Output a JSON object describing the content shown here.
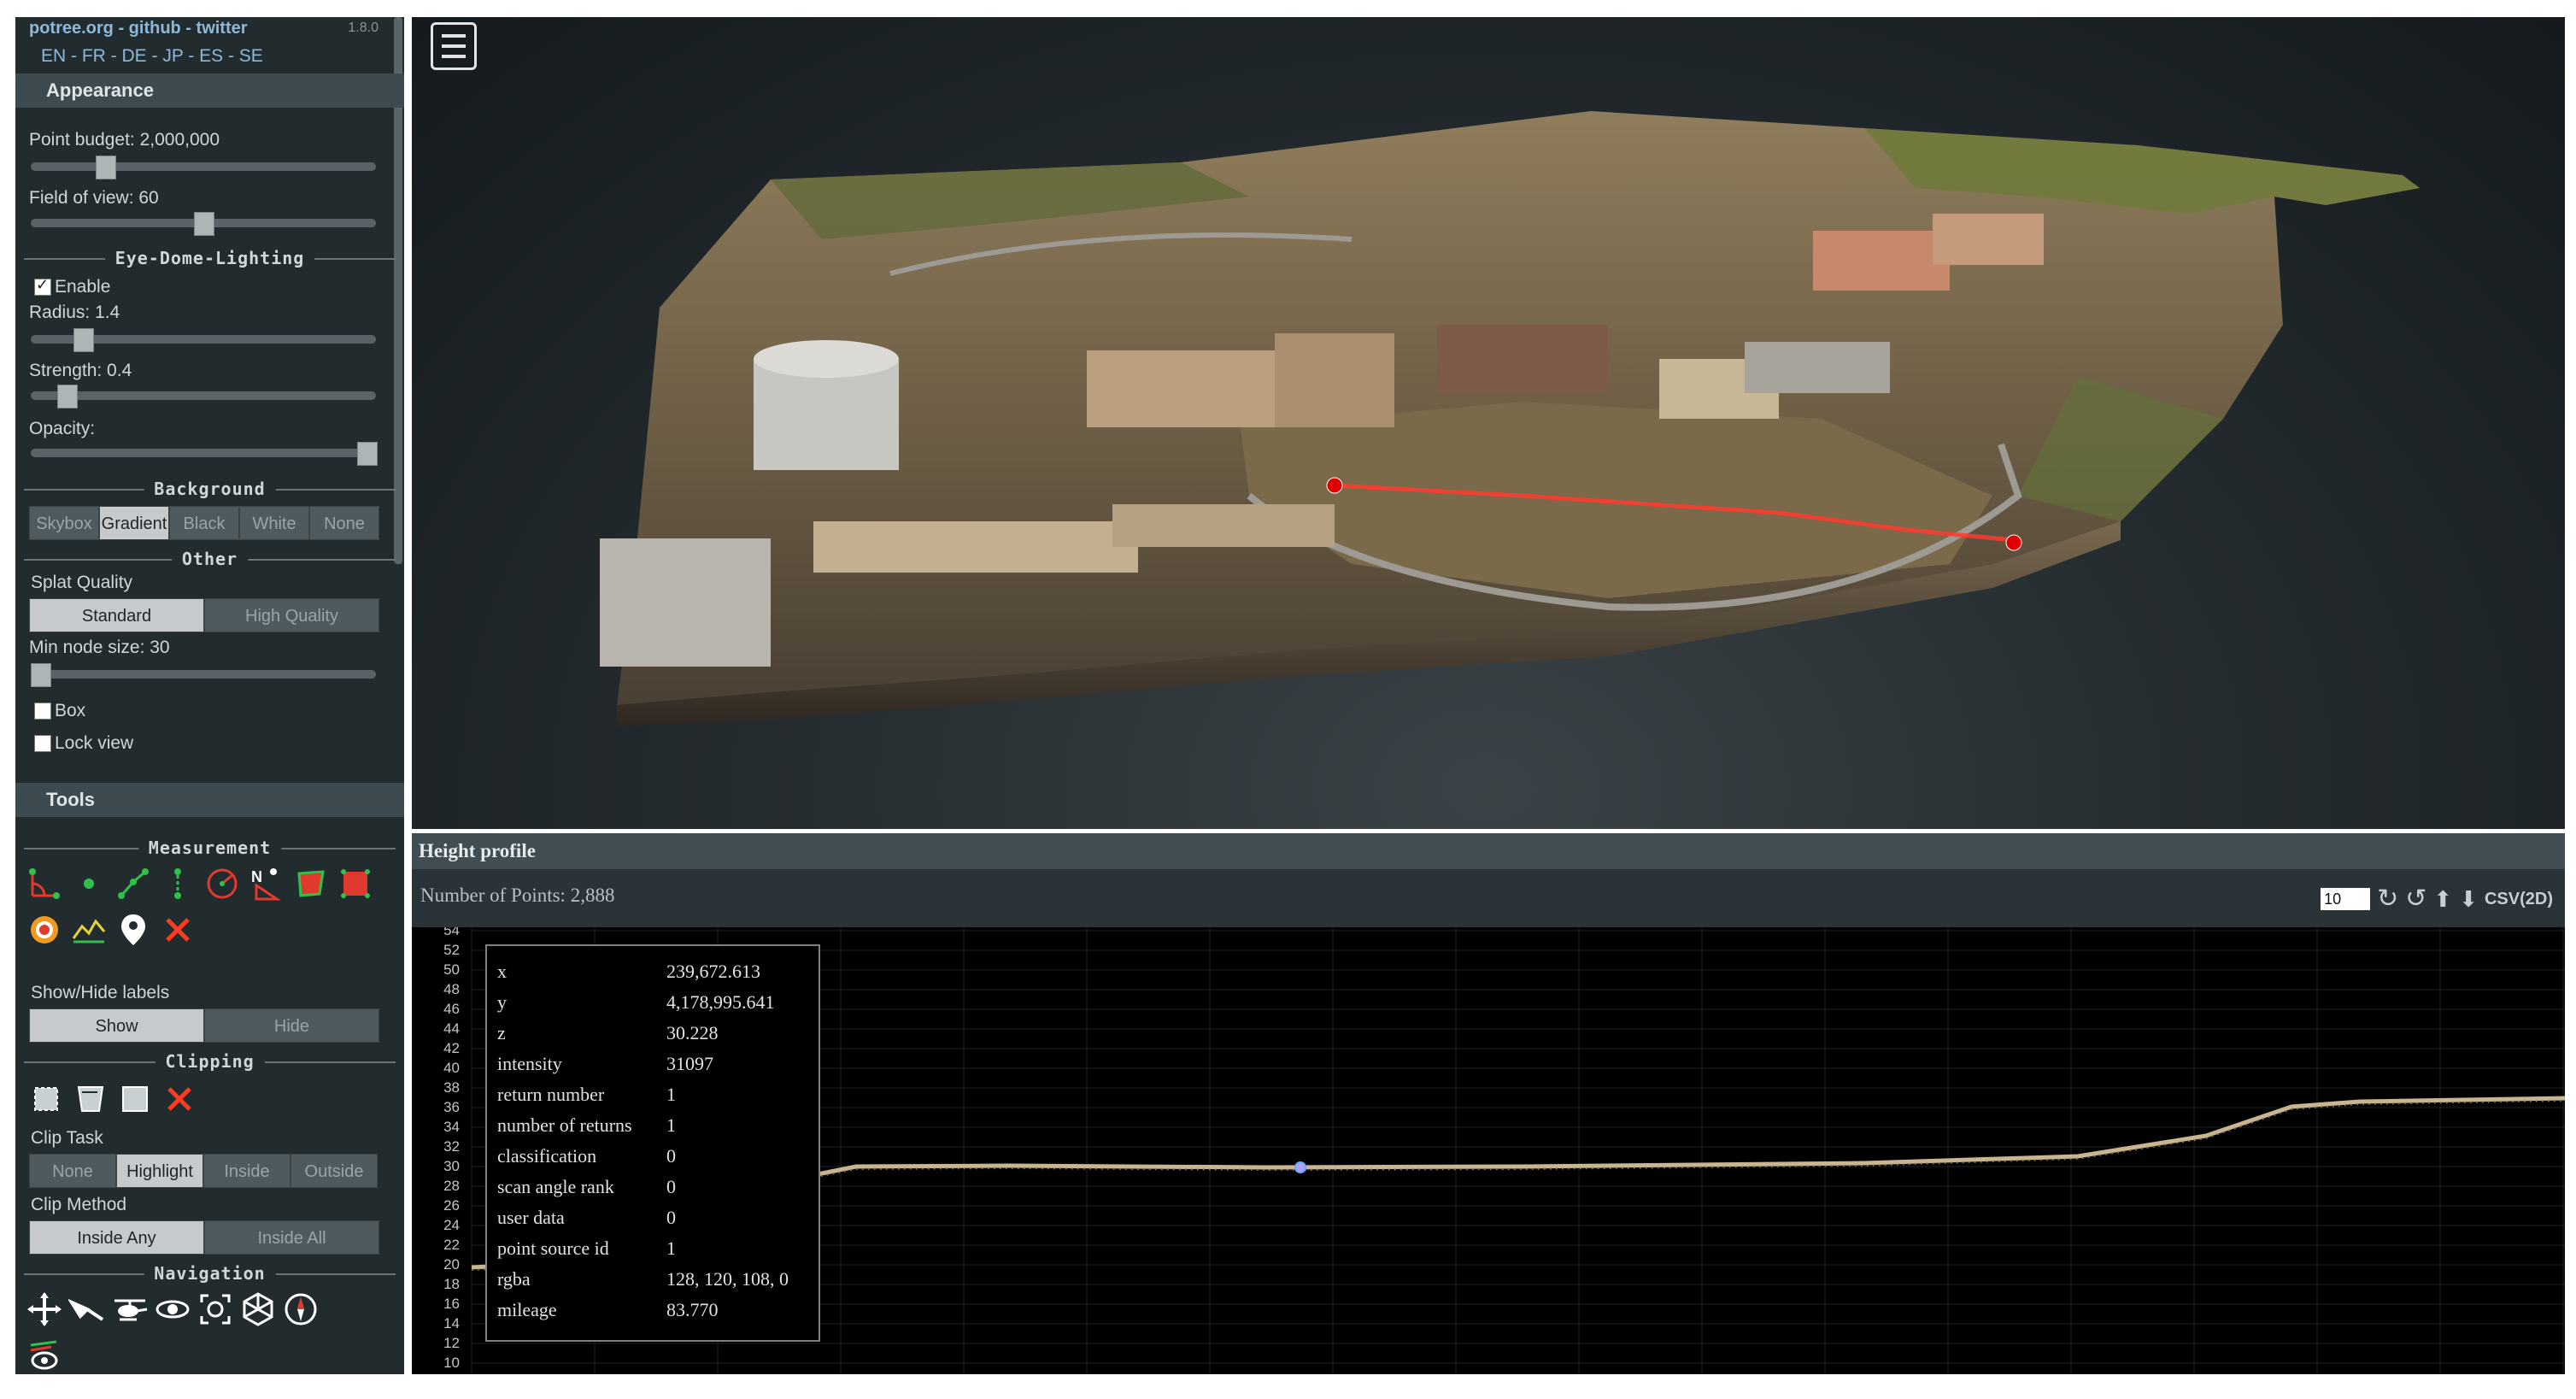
{
  "sidebar": {
    "links": "potree.org - github - twitter",
    "version": "1.8.0",
    "languages": "EN - FR - DE - JP - ES - SE",
    "appearance_header": "Appearance",
    "point_budget_label": "Point budget: 2,000,000",
    "point_budget_level": 0.2,
    "fov_label": "Field of view: 60",
    "fov_level": 0.5,
    "edl_title": "Eye-Dome-Lighting",
    "edl_enable_label": "Enable",
    "edl_enabled": true,
    "radius_label": "Radius: 1.4",
    "radius_level": 0.13,
    "strength_label": "Strength: 0.4",
    "strength_level": 0.08,
    "opacity_label": "Opacity:",
    "opacity_level": 1.0,
    "background_title": "Background",
    "background_options": [
      "Skybox",
      "Gradient",
      "Black",
      "White",
      "None"
    ],
    "background_selected": "Gradient",
    "other_title": "Other",
    "splat_quality_label": "Splat Quality",
    "splat_options": [
      "Standard",
      "High Quality"
    ],
    "splat_selected": "Standard",
    "min_node_label": "Min node size: 30",
    "min_node_level": 0.0,
    "box_label": "Box",
    "lock_view_label": "Lock view",
    "tools_header": "Tools",
    "measurement_title": "Measurement",
    "measurement_icons": [
      "angle-icon",
      "point-icon",
      "distance-icon",
      "height-icon",
      "circle-icon",
      "azimuth-icon",
      "area-icon",
      "volume-icon",
      "sphere-volume-icon",
      "height-profile-icon",
      "annotation-icon",
      "remove-measurements-icon"
    ],
    "show_hide_label": "Show/Hide labels",
    "show_hide_options": [
      "Show",
      "Hide"
    ],
    "show_hide_selected": "Show",
    "clipping_title": "Clipping",
    "clipping_icons": [
      "clip-volume-icon",
      "clip-polygon-icon",
      "clip-screen-box-icon",
      "remove-clip-icon"
    ],
    "clip_task_label": "Clip Task",
    "clip_task_options": [
      "None",
      "Highlight",
      "Inside",
      "Outside"
    ],
    "clip_task_selected": "Highlight",
    "clip_method_label": "Clip Method",
    "clip_method_options": [
      "Inside Any",
      "Inside All"
    ],
    "clip_method_selected": "Inside Any",
    "navigation_title": "Navigation",
    "navigation_icons": [
      "earth-controls-icon",
      "fly-controls-icon",
      "helicopter-controls-icon",
      "orbit-controls-icon",
      "focus-icon",
      "cube-view-icon",
      "compass-icon",
      "camera-animation-icon"
    ]
  },
  "viewport": {
    "menu_icon": "hamburger-menu-icon",
    "profile_line_color": "#ff3b2f",
    "marker_color": "#e00000"
  },
  "profile": {
    "title": "Height profile",
    "points_label": "Number of Points:",
    "points_value": "2,888",
    "width_value": "10",
    "csv_label": "CSV(2D)",
    "control_icons": [
      "rotate-cw-icon",
      "rotate-ccw-icon",
      "move-up-icon",
      "download-icon"
    ],
    "y_ticks": [
      "54",
      "52",
      "50",
      "48",
      "46",
      "44",
      "42",
      "40",
      "38",
      "36",
      "34",
      "32",
      "30",
      "28",
      "26",
      "24",
      "22",
      "20",
      "18",
      "16",
      "14",
      "12",
      "10"
    ],
    "point_info": [
      {
        "k": "x",
        "v": "239,672.613"
      },
      {
        "k": "y",
        "v": "4,178,995.641"
      },
      {
        "k": "z",
        "v": "30.228"
      },
      {
        "k": "intensity",
        "v": "31097"
      },
      {
        "k": "return number",
        "v": "1"
      },
      {
        "k": "number of returns",
        "v": "1"
      },
      {
        "k": "classification",
        "v": "0"
      },
      {
        "k": "scan angle rank",
        "v": "0"
      },
      {
        "k": "user data",
        "v": "0"
      },
      {
        "k": "point source id",
        "v": "1"
      },
      {
        "k": "rgba",
        "v": "128, 120, 108, 0"
      },
      {
        "k": "mileage",
        "v": "83.770"
      }
    ]
  }
}
